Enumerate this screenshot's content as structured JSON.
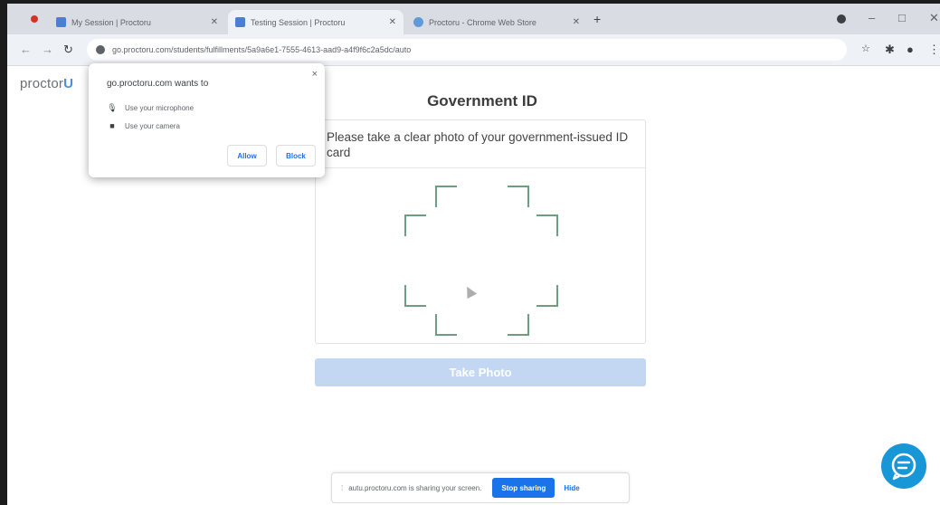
{
  "browser": {
    "tabs": [
      {
        "title": "My Session | Proctoru"
      },
      {
        "title": "Testing Session | Proctoru"
      },
      {
        "title": "Proctoru - Chrome Web Store"
      }
    ],
    "new_tab_glyph": "+",
    "url": "go.proctoru.com/students/fulfillments/5a9a6e1-7555-4613-aad9-a4f9f6c2a5dc/auto",
    "window_controls": [
      "–",
      "□"
    ]
  },
  "page": {
    "brand": "proctor",
    "brand_mark": "U",
    "title": "Government ID",
    "instruction": "Please take a clear photo of your government-issued ID card",
    "take_photo_label": "Take Photo"
  },
  "permission_popup": {
    "origin_text": "go.proctoru.com wants to",
    "permissions": [
      {
        "icon": "microphone-icon",
        "label": "Use your microphone"
      },
      {
        "icon": "camera-icon",
        "label": "Use your camera"
      }
    ],
    "allow_label": "Allow",
    "block_label": "Block",
    "close_glyph": "×"
  },
  "share_bar": {
    "message": "autu.proctoru.com is sharing your screen.",
    "stop_label": "Stop sharing",
    "hide_label": "Hide"
  },
  "colors": {
    "accent": "#1a73e8",
    "frame_green": "#6e9e82",
    "chat_blue": "#1796d8",
    "button_disabled": "#c3d7f3"
  }
}
